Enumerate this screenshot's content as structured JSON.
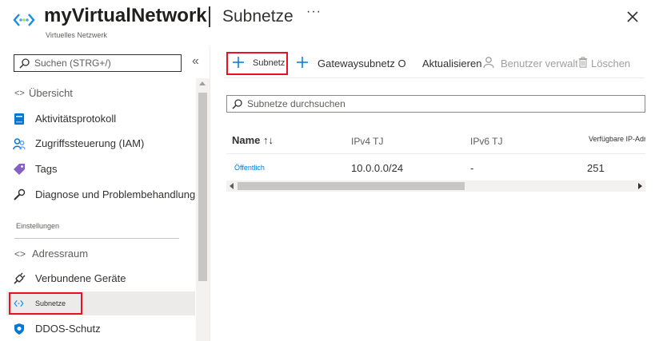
{
  "header": {
    "resource_name": "myVirtualNetwork",
    "separator": "|",
    "page_title": "Subnetze",
    "more": "···",
    "subtitle": "Virtuelles Netzwerk",
    "resource_icon": "vnet-icon",
    "close_icon": "close-icon"
  },
  "sidebar": {
    "search_placeholder": "Suchen (STRG+/)",
    "collapse": "«",
    "items": [
      {
        "label": "Übersicht",
        "icon": "overview-icon"
      },
      {
        "label": "Aktivitätsprotokoll",
        "icon": "activity-log-icon"
      },
      {
        "label": "Zugriffssteuerung (IAM)",
        "icon": "iam-icon"
      },
      {
        "label": "Tags",
        "icon": "tag-icon"
      },
      {
        "label": "Diagnose und Problembehandlung",
        "icon": "wrench-icon"
      },
      {
        "label": "Adressraum",
        "icon": "address-space-icon"
      },
      {
        "label": "Verbundene Geräte",
        "icon": "plug-icon"
      },
      {
        "label": "Subnetze",
        "icon": "subnet-icon"
      },
      {
        "label": "DDOS-Schutz",
        "icon": "shield-icon"
      }
    ],
    "section_label": "Einstellungen",
    "active_item": "Subnetze"
  },
  "toolbar": {
    "add_subnet": "Subnetz",
    "gateway_subnet": "Gatewaysubnetz O",
    "refresh": "Aktualisieren",
    "manage_users": "Benutzer verwalten",
    "delete": "Löschen"
  },
  "subnet_search": {
    "placeholder": "Subnetze durchsuchen"
  },
  "table": {
    "columns": [
      "Name ↑↓",
      "IPv4 TJ",
      "IPv6 TJ",
      "Verfügbare IP-Adressen"
    ],
    "rows": [
      {
        "name": "Öffentlich",
        "ipv4": "10.0.0.0/24",
        "ipv6": "-",
        "available": "251"
      }
    ]
  },
  "colors": {
    "accent_blue": "#0078d4",
    "highlight_red": "#e81123",
    "link_blue": "#0078d4"
  }
}
